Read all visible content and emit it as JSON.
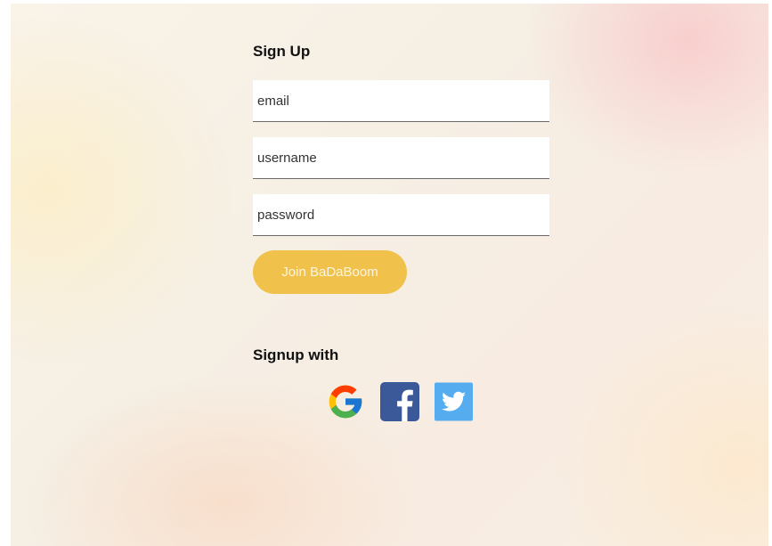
{
  "signup": {
    "title": "Sign Up",
    "email_placeholder": "email",
    "username_placeholder": "username",
    "password_placeholder": "password",
    "submit_label": "Join BaDaBoom"
  },
  "social": {
    "heading": "Signup with",
    "providers": [
      {
        "icon": "google-icon"
      },
      {
        "icon": "facebook-icon"
      },
      {
        "icon": "twitter-icon"
      }
    ]
  },
  "colors": {
    "accent_button": "#f0c14b",
    "button_text": "#fbf5e4",
    "facebook": "#3b5998",
    "twitter": "#55acee"
  }
}
